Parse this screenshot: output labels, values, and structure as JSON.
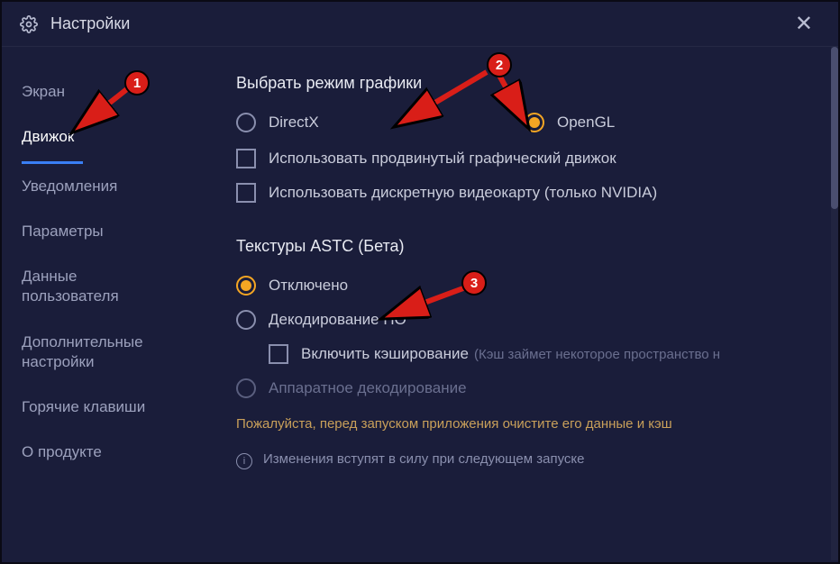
{
  "titlebar": {
    "title": "Настройки"
  },
  "sidebar": {
    "items": [
      {
        "label": "Экран"
      },
      {
        "label": "Движок"
      },
      {
        "label": "Уведомления"
      },
      {
        "label": "Параметры"
      },
      {
        "label": "Данные пользователя"
      },
      {
        "label": "Дополнительные настройки"
      },
      {
        "label": "Горячие клавиши"
      },
      {
        "label": "О продукте"
      }
    ]
  },
  "main": {
    "section1_title": "Выбрать режим графики",
    "radio_directx": "DirectX",
    "radio_opengl": "OpenGL",
    "checkbox_advanced_engine": "Использовать продвинутый графический движок",
    "checkbox_discrete_gpu": "Использовать дискретную видеокарту (только NVIDIA)",
    "section2_title": "Текстуры ASTC (Бета)",
    "radio_disabled": "Отключено",
    "radio_sw_decode": "Декодирование ПО",
    "checkbox_caching": "Включить кэширование",
    "caching_hint": "(Кэш займет некоторое пространство н",
    "radio_hw_decode": "Аппаратное декодирование",
    "warning": "Пожалуйста, перед запуском приложения очистите его данные и кэш",
    "info_text": "Изменения вступят в силу при следующем запуске"
  },
  "annotations": {
    "marker1": "1",
    "marker2": "2",
    "marker3": "3"
  }
}
